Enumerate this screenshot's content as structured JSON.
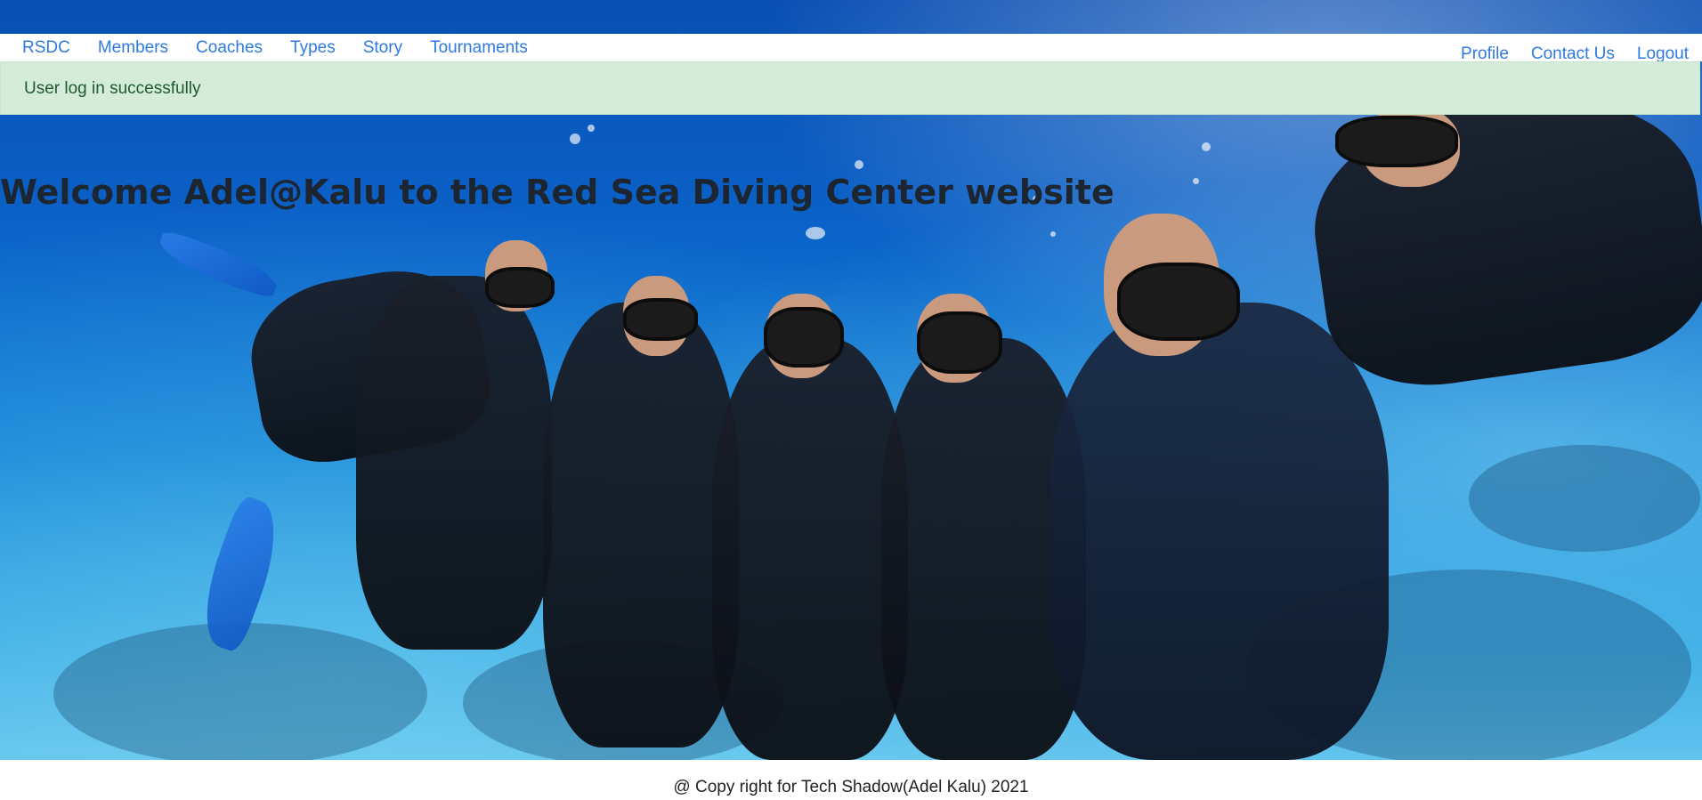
{
  "navbar": {
    "brand": "RSDC",
    "left_links": [
      "Members",
      "Coaches",
      "Types",
      "Story",
      "Tournaments"
    ],
    "right_links": [
      "Profile",
      "Contact Us",
      "Logout"
    ],
    "link_color": "#2f7ae0"
  },
  "alert": {
    "message": "User log in successfully",
    "color": "#d4ecd9"
  },
  "hero": {
    "heading": "Welcome Adel@Kalu to the Red Sea Diving Center website",
    "background": "underwater-divers-photo"
  },
  "footer": {
    "text": "@ Copy right for Tech Shadow(Adel Kalu) 2021"
  }
}
